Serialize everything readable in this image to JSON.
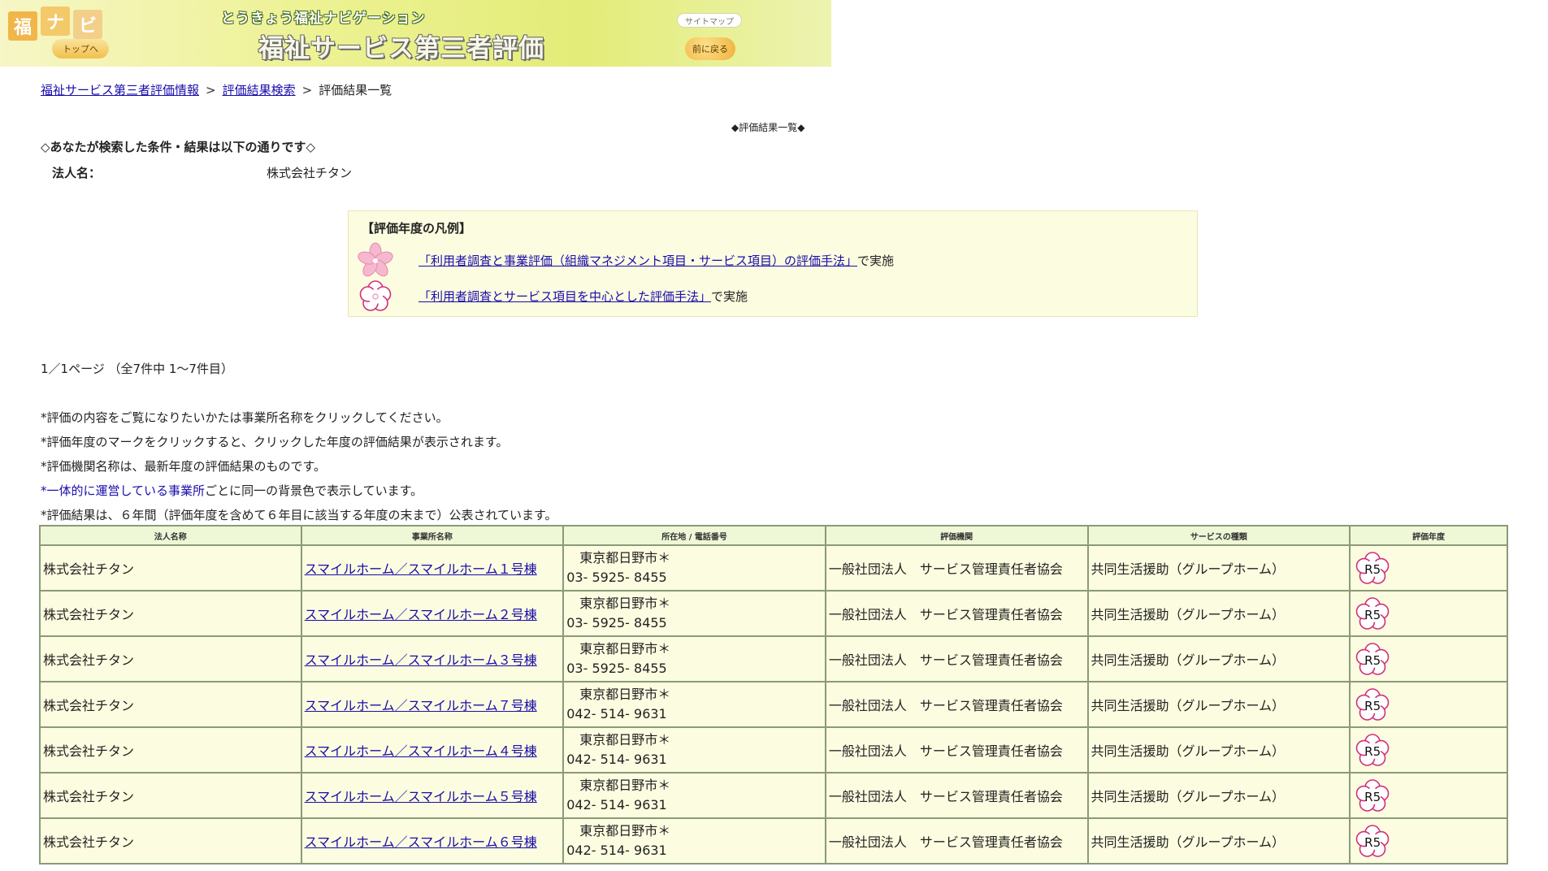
{
  "header": {
    "logo_chars": [
      "福",
      "ナ",
      "ビ"
    ],
    "top_button": "トップへ",
    "subtitle": "とうきょう福祉ナビゲーション",
    "title": "福祉サービス第三者評価",
    "sitemap": "サイトマップ",
    "back": "前に戻る"
  },
  "breadcrumb": {
    "items": [
      "福祉サービス第三者評価情報",
      "評価結果検索"
    ],
    "current": "評価結果一覧",
    "separator": ">"
  },
  "page_marker": "◆評価結果一覧◆",
  "conditions": {
    "heading": "◇あなたが検索した条件・結果は以下の通りです◇",
    "corp_label": "法人名：",
    "corp_value": "株式会社チタン"
  },
  "legend": {
    "title": "【評価年度の凡例】",
    "items": [
      {
        "link": "「利用者調査と事業評価（組織マネジメント項目・サービス項目）の評価手法」",
        "suffix": "で実施",
        "icon": "sakura-filled-icon"
      },
      {
        "link": "「利用者調査とサービス項目を中心とした評価手法」",
        "suffix": "で実施",
        "icon": "sakura-outline-icon"
      }
    ]
  },
  "paging": "1／1ページ （全7件中 1～7件目）",
  "notes": {
    "n1": "*評価の内容をご覧になりたいかたは事業所名称をクリックしてください。",
    "n2": "*評価年度のマークをクリックすると、クリックした年度の評価結果が表示されます。",
    "n3": "*評価機関名称は、最新年度の評価結果のものです。",
    "n4_prefix": "*",
    "n4_link": "一体的に運営している事業所",
    "n4_suffix": "ごとに同一の背景色で表示しています。",
    "n5": "*評価結果は、６年間（評価年度を含めて６年目に該当する年度の末まで）公表されています。"
  },
  "table": {
    "headers": [
      "法人名称",
      "事業所名称",
      "所在地 / 電話番号",
      "評価機関",
      "サービスの種類",
      "評価年度"
    ],
    "rows": [
      {
        "corp": "株式会社チタン",
        "office": "スマイルホーム／スマイルホーム１号棟",
        "addr": "東京都日野市＊",
        "tel": "03- 5925- 8455",
        "org": "一般社団法人　サービス管理責任者協会",
        "service": "共同生活援助（グループホーム）",
        "year": "R5"
      },
      {
        "corp": "株式会社チタン",
        "office": "スマイルホーム／スマイルホーム２号棟",
        "addr": "東京都日野市＊",
        "tel": "03- 5925- 8455",
        "org": "一般社団法人　サービス管理責任者協会",
        "service": "共同生活援助（グループホーム）",
        "year": "R5"
      },
      {
        "corp": "株式会社チタン",
        "office": "スマイルホーム／スマイルホーム３号棟",
        "addr": "東京都日野市＊",
        "tel": "03- 5925- 8455",
        "org": "一般社団法人　サービス管理責任者協会",
        "service": "共同生活援助（グループホーム）",
        "year": "R5"
      },
      {
        "corp": "株式会社チタン",
        "office": "スマイルホーム／スマイルホーム７号棟",
        "addr": "東京都日野市＊",
        "tel": "042- 514- 9631",
        "org": "一般社団法人　サービス管理責任者協会",
        "service": "共同生活援助（グループホーム）",
        "year": "R5"
      },
      {
        "corp": "株式会社チタン",
        "office": "スマイルホーム／スマイルホーム４号棟",
        "addr": "東京都日野市＊",
        "tel": "042- 514- 9631",
        "org": "一般社団法人　サービス管理責任者協会",
        "service": "共同生活援助（グループホーム）",
        "year": "R5"
      },
      {
        "corp": "株式会社チタン",
        "office": "スマイルホーム／スマイルホーム５号棟",
        "addr": "東京都日野市＊",
        "tel": "042- 514- 9631",
        "org": "一般社団法人　サービス管理責任者協会",
        "service": "共同生活援助（グループホーム）",
        "year": "R5"
      },
      {
        "corp": "株式会社チタン",
        "office": "スマイルホーム／スマイルホーム６号棟",
        "addr": "東京都日野市＊",
        "tel": "042- 514- 9631",
        "org": "一般社団法人　サービス管理責任者協会",
        "service": "共同生活援助（グループホーム）",
        "year": "R5"
      }
    ]
  },
  "colors": {
    "link": "#1a0dab",
    "table_bg": "#fcfce0",
    "header_bg": "#eef7d6",
    "sakura_pink": "#f4a7c3",
    "mark_outline": "#d0307a"
  }
}
